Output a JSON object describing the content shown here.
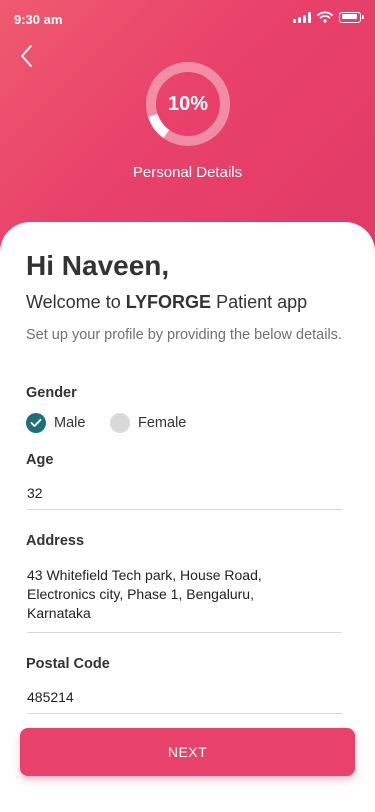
{
  "status_bar": {
    "time": "9:30 am"
  },
  "header": {
    "progress_label": "10%",
    "progress_fraction": 0.1,
    "step_title": "Personal Details",
    "colors": {
      "gradient_start": "#ef5a6f",
      "gradient_end": "#e23a67"
    }
  },
  "intro": {
    "greeting": "Hi Naveen,",
    "welcome_prefix": "Welcome to ",
    "brand": "LYFORGE",
    "welcome_suffix": " Patient app",
    "description": "Set up your profile by providing the below details."
  },
  "gender": {
    "label": "Gender",
    "options": [
      {
        "label": "Male",
        "selected": true
      },
      {
        "label": "Female",
        "selected": false
      }
    ]
  },
  "age": {
    "label": "Age",
    "value": "32"
  },
  "address": {
    "label": "Address",
    "value": "43 Whitefield Tech park, House Road, Electronics city, Phase 1, Bengaluru, Karnataka"
  },
  "postal_code": {
    "label": "Postal Code",
    "value": "485214"
  },
  "next_button": {
    "label": "NEXT",
    "color": "#e8426a"
  },
  "icons": {
    "back": "chevron-left-icon",
    "check": "check-icon",
    "signal": "signal-icon",
    "wifi": "wifi-icon",
    "battery": "battery-icon"
  }
}
